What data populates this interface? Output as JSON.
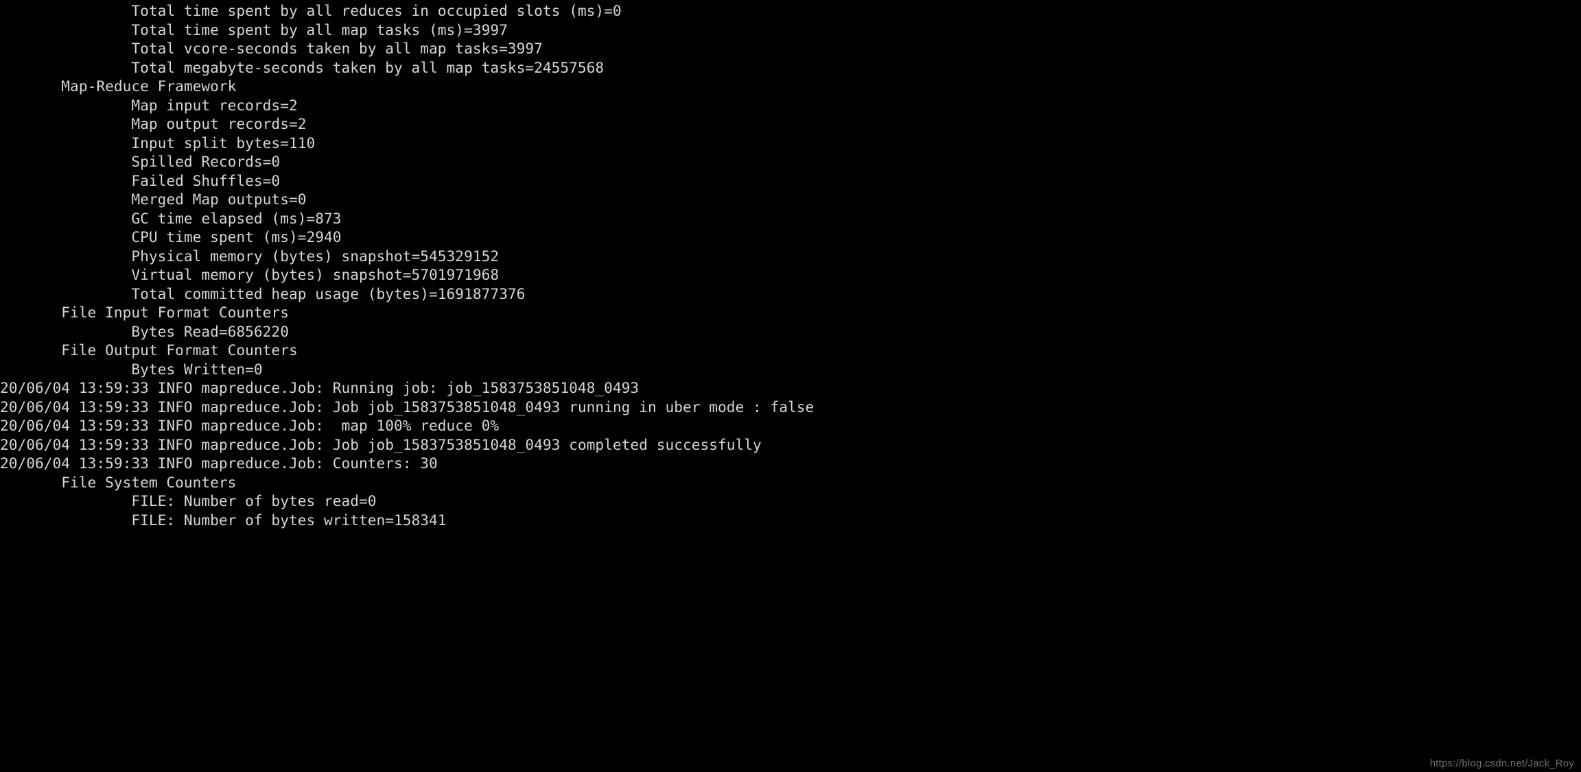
{
  "window": {
    "type": "terminal-console",
    "background_color": "#000000",
    "text_color": "#d5d5d5"
  },
  "watermark": {
    "text": "https://blog.csdn.net/Jack_Roy",
    "color": "#6f6f6f"
  },
  "console": {
    "lines": [
      "               Total time spent by all reduces in occupied slots (ms)=0",
      "               Total time spent by all map tasks (ms)=3997",
      "               Total vcore-seconds taken by all map tasks=3997",
      "               Total megabyte-seconds taken by all map tasks=24557568",
      "       Map-Reduce Framework",
      "               Map input records=2",
      "               Map output records=2",
      "               Input split bytes=110",
      "               Spilled Records=0",
      "               Failed Shuffles=0",
      "               Merged Map outputs=0",
      "               GC time elapsed (ms)=873",
      "               CPU time spent (ms)=2940",
      "               Physical memory (bytes) snapshot=545329152",
      "               Virtual memory (bytes) snapshot=5701971968",
      "               Total committed heap usage (bytes)=1691877376",
      "       File Input Format Counters",
      "               Bytes Read=6856220",
      "       File Output Format Counters",
      "               Bytes Written=0",
      "20/06/04 13:59:33 INFO mapreduce.Job: Running job: job_1583753851048_0493",
      "20/06/04 13:59:33 INFO mapreduce.Job: Job job_1583753851048_0493 running in uber mode : false",
      "20/06/04 13:59:33 INFO mapreduce.Job:  map 100% reduce 0%",
      "20/06/04 13:59:33 INFO mapreduce.Job: Job job_1583753851048_0493 completed successfully",
      "20/06/04 13:59:33 INFO mapreduce.Job: Counters: 30",
      "       File System Counters",
      "               FILE: Number of bytes read=0",
      "               FILE: Number of bytes written=158341"
    ],
    "counter_groups": [
      "Map-Reduce Framework",
      "File Input Format Counters",
      "File Output Format Counters",
      "File System Counters"
    ],
    "counters": {
      "total_time_all_reduces_occupied_slots_ms": 0,
      "total_time_all_map_tasks_ms": 3997,
      "total_vcore_seconds_all_map_tasks": 3997,
      "total_megabyte_seconds_all_map_tasks": 24557568,
      "map_input_records": 2,
      "map_output_records": 2,
      "input_split_bytes": 110,
      "spilled_records": 0,
      "failed_shuffles": 0,
      "merged_map_outputs": 0,
      "gc_time_elapsed_ms": 873,
      "cpu_time_spent_ms": 2940,
      "physical_memory_bytes_snapshot": 545329152,
      "virtual_memory_bytes_snapshot": 5701971968,
      "total_committed_heap_usage_bytes": 1691877376,
      "bytes_read": 6856220,
      "bytes_written": 0,
      "file_number_of_bytes_read": 0,
      "file_number_of_bytes_written": 158341,
      "counters_total": 30
    },
    "job": {
      "id": "job_1583753851048_0493",
      "timestamp": "20/06/04 13:59:33",
      "log_level": "INFO",
      "logger": "mapreduce.Job",
      "uber_mode": "false",
      "map_progress": "100%",
      "reduce_progress": "0%",
      "status": "completed successfully"
    }
  }
}
